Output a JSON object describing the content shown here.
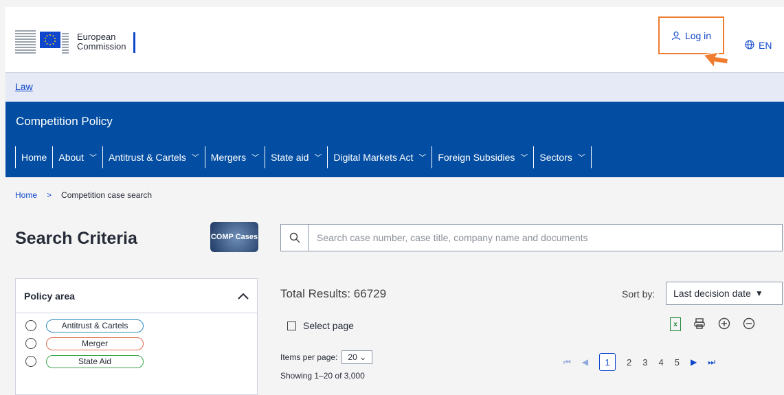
{
  "header": {
    "logo_line1": "European",
    "logo_line2": "Commission",
    "login_label": "Log in",
    "lang_label": "EN"
  },
  "lawbar": {
    "link": "Law"
  },
  "site": {
    "title": "Competition Policy",
    "nav": [
      {
        "label": "Home"
      },
      {
        "label": "About"
      },
      {
        "label": "Antitrust & Cartels"
      },
      {
        "label": "Mergers"
      },
      {
        "label": "State aid"
      },
      {
        "label": "Digital Markets Act"
      },
      {
        "label": "Foreign Subsidies"
      },
      {
        "label": "Sectors"
      }
    ]
  },
  "breadcrumb": {
    "home": "Home",
    "separator": ">",
    "current": "Competition case search"
  },
  "search": {
    "title": "Search Criteria",
    "comp_icon_text": "COMP Cases",
    "placeholder": "Search case number, case title, company name and documents"
  },
  "policy": {
    "title": "Policy area",
    "items": [
      {
        "label": "Antitrust & Cartels",
        "color": "#2b8bbd"
      },
      {
        "label": "Merger",
        "color": "#e06a4b"
      },
      {
        "label": "State Aid",
        "color": "#3aa84a"
      }
    ]
  },
  "results": {
    "total_label": "Total Results:",
    "total_value": "66729",
    "sort_label": "Sort by:",
    "sort_value": "Last decision date",
    "select_page": "Select page",
    "items_per_page_label": "Items per page:",
    "items_per_page_value": "20",
    "showing": "Showing 1–20 of 3,000",
    "pages": [
      "1",
      "2",
      "3",
      "4",
      "5"
    ],
    "current_page": "1"
  },
  "colors": {
    "brand_blue": "#034ea2",
    "link_blue": "#0e47cb",
    "highlight": "#f07c2f"
  }
}
